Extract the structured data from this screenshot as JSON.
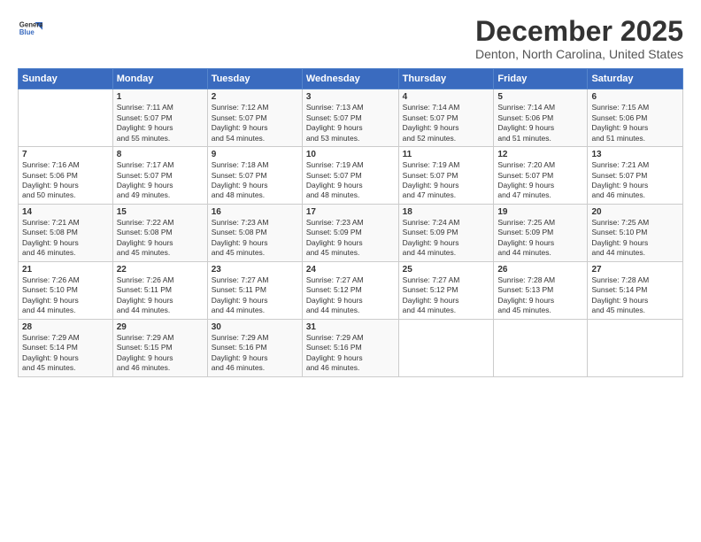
{
  "header": {
    "logo_line1": "General",
    "logo_line2": "Blue",
    "month": "December 2025",
    "location": "Denton, North Carolina, United States"
  },
  "days_of_week": [
    "Sunday",
    "Monday",
    "Tuesday",
    "Wednesday",
    "Thursday",
    "Friday",
    "Saturday"
  ],
  "weeks": [
    [
      {
        "day": "",
        "content": ""
      },
      {
        "day": "1",
        "content": "Sunrise: 7:11 AM\nSunset: 5:07 PM\nDaylight: 9 hours\nand 55 minutes."
      },
      {
        "day": "2",
        "content": "Sunrise: 7:12 AM\nSunset: 5:07 PM\nDaylight: 9 hours\nand 54 minutes."
      },
      {
        "day": "3",
        "content": "Sunrise: 7:13 AM\nSunset: 5:07 PM\nDaylight: 9 hours\nand 53 minutes."
      },
      {
        "day": "4",
        "content": "Sunrise: 7:14 AM\nSunset: 5:07 PM\nDaylight: 9 hours\nand 52 minutes."
      },
      {
        "day": "5",
        "content": "Sunrise: 7:14 AM\nSunset: 5:06 PM\nDaylight: 9 hours\nand 51 minutes."
      },
      {
        "day": "6",
        "content": "Sunrise: 7:15 AM\nSunset: 5:06 PM\nDaylight: 9 hours\nand 51 minutes."
      }
    ],
    [
      {
        "day": "7",
        "content": "Sunrise: 7:16 AM\nSunset: 5:06 PM\nDaylight: 9 hours\nand 50 minutes."
      },
      {
        "day": "8",
        "content": "Sunrise: 7:17 AM\nSunset: 5:07 PM\nDaylight: 9 hours\nand 49 minutes."
      },
      {
        "day": "9",
        "content": "Sunrise: 7:18 AM\nSunset: 5:07 PM\nDaylight: 9 hours\nand 48 minutes."
      },
      {
        "day": "10",
        "content": "Sunrise: 7:19 AM\nSunset: 5:07 PM\nDaylight: 9 hours\nand 48 minutes."
      },
      {
        "day": "11",
        "content": "Sunrise: 7:19 AM\nSunset: 5:07 PM\nDaylight: 9 hours\nand 47 minutes."
      },
      {
        "day": "12",
        "content": "Sunrise: 7:20 AM\nSunset: 5:07 PM\nDaylight: 9 hours\nand 47 minutes."
      },
      {
        "day": "13",
        "content": "Sunrise: 7:21 AM\nSunset: 5:07 PM\nDaylight: 9 hours\nand 46 minutes."
      }
    ],
    [
      {
        "day": "14",
        "content": "Sunrise: 7:21 AM\nSunset: 5:08 PM\nDaylight: 9 hours\nand 46 minutes."
      },
      {
        "day": "15",
        "content": "Sunrise: 7:22 AM\nSunset: 5:08 PM\nDaylight: 9 hours\nand 45 minutes."
      },
      {
        "day": "16",
        "content": "Sunrise: 7:23 AM\nSunset: 5:08 PM\nDaylight: 9 hours\nand 45 minutes."
      },
      {
        "day": "17",
        "content": "Sunrise: 7:23 AM\nSunset: 5:09 PM\nDaylight: 9 hours\nand 45 minutes."
      },
      {
        "day": "18",
        "content": "Sunrise: 7:24 AM\nSunset: 5:09 PM\nDaylight: 9 hours\nand 44 minutes."
      },
      {
        "day": "19",
        "content": "Sunrise: 7:25 AM\nSunset: 5:09 PM\nDaylight: 9 hours\nand 44 minutes."
      },
      {
        "day": "20",
        "content": "Sunrise: 7:25 AM\nSunset: 5:10 PM\nDaylight: 9 hours\nand 44 minutes."
      }
    ],
    [
      {
        "day": "21",
        "content": "Sunrise: 7:26 AM\nSunset: 5:10 PM\nDaylight: 9 hours\nand 44 minutes."
      },
      {
        "day": "22",
        "content": "Sunrise: 7:26 AM\nSunset: 5:11 PM\nDaylight: 9 hours\nand 44 minutes."
      },
      {
        "day": "23",
        "content": "Sunrise: 7:27 AM\nSunset: 5:11 PM\nDaylight: 9 hours\nand 44 minutes."
      },
      {
        "day": "24",
        "content": "Sunrise: 7:27 AM\nSunset: 5:12 PM\nDaylight: 9 hours\nand 44 minutes."
      },
      {
        "day": "25",
        "content": "Sunrise: 7:27 AM\nSunset: 5:12 PM\nDaylight: 9 hours\nand 44 minutes."
      },
      {
        "day": "26",
        "content": "Sunrise: 7:28 AM\nSunset: 5:13 PM\nDaylight: 9 hours\nand 45 minutes."
      },
      {
        "day": "27",
        "content": "Sunrise: 7:28 AM\nSunset: 5:14 PM\nDaylight: 9 hours\nand 45 minutes."
      }
    ],
    [
      {
        "day": "28",
        "content": "Sunrise: 7:29 AM\nSunset: 5:14 PM\nDaylight: 9 hours\nand 45 minutes."
      },
      {
        "day": "29",
        "content": "Sunrise: 7:29 AM\nSunset: 5:15 PM\nDaylight: 9 hours\nand 46 minutes."
      },
      {
        "day": "30",
        "content": "Sunrise: 7:29 AM\nSunset: 5:16 PM\nDaylight: 9 hours\nand 46 minutes."
      },
      {
        "day": "31",
        "content": "Sunrise: 7:29 AM\nSunset: 5:16 PM\nDaylight: 9 hours\nand 46 minutes."
      },
      {
        "day": "",
        "content": ""
      },
      {
        "day": "",
        "content": ""
      },
      {
        "day": "",
        "content": ""
      }
    ]
  ]
}
